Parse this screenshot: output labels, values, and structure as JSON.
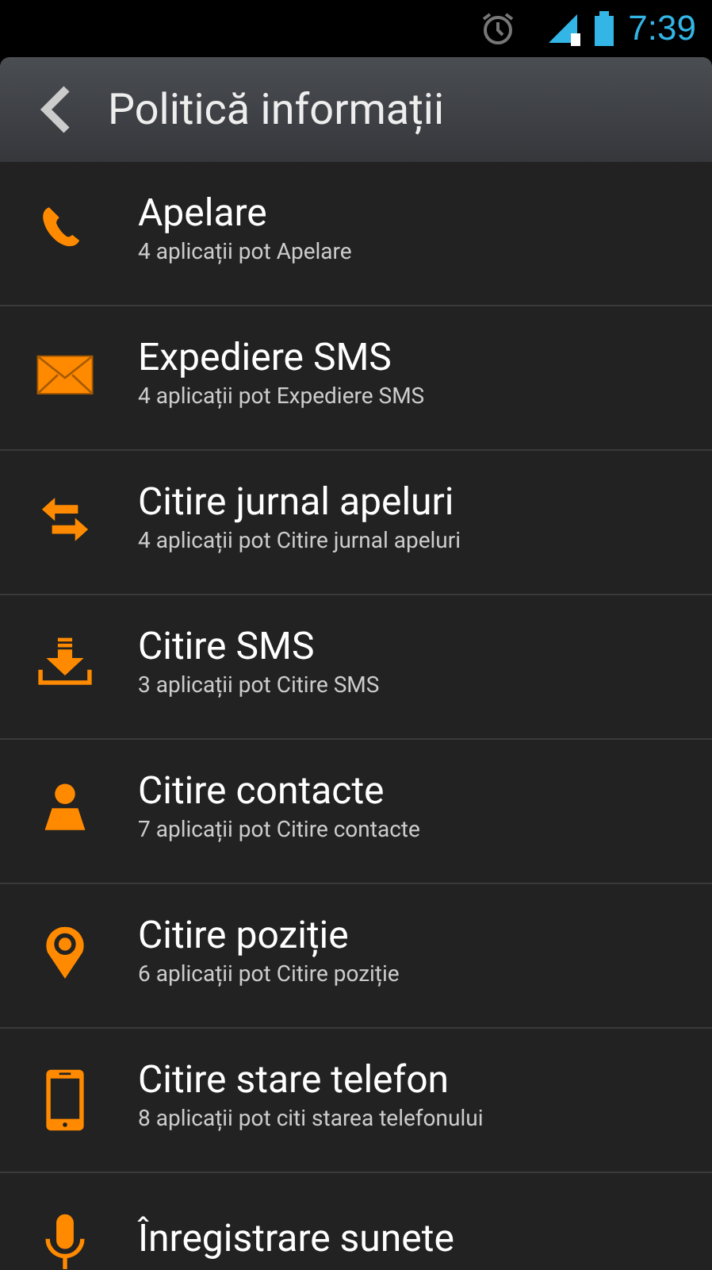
{
  "status_bar": {
    "time": "7:39"
  },
  "action_bar": {
    "title": "Politică informații"
  },
  "items": [
    {
      "kind": "phone",
      "title": "Apelare",
      "subtitle": "4 aplicații pot Apelare"
    },
    {
      "kind": "mail",
      "title": "Expediere SMS",
      "subtitle": "4 aplicații pot Expediere SMS"
    },
    {
      "kind": "arrows",
      "title": "Citire jurnal apeluri",
      "subtitle": "4 aplicații pot Citire jurnal apeluri"
    },
    {
      "kind": "download",
      "title": "Citire SMS",
      "subtitle": "3 aplicații pot Citire SMS"
    },
    {
      "kind": "person",
      "title": "Citire contacte",
      "subtitle": "7 aplicații pot Citire contacte"
    },
    {
      "kind": "pin",
      "title": "Citire poziție",
      "subtitle": "6 aplicații pot Citire poziție"
    },
    {
      "kind": "device",
      "title": "Citire stare telefon",
      "subtitle": "8 aplicații pot citi starea telefonului"
    },
    {
      "kind": "mic",
      "title": "Înregistrare sunete"
    }
  ]
}
